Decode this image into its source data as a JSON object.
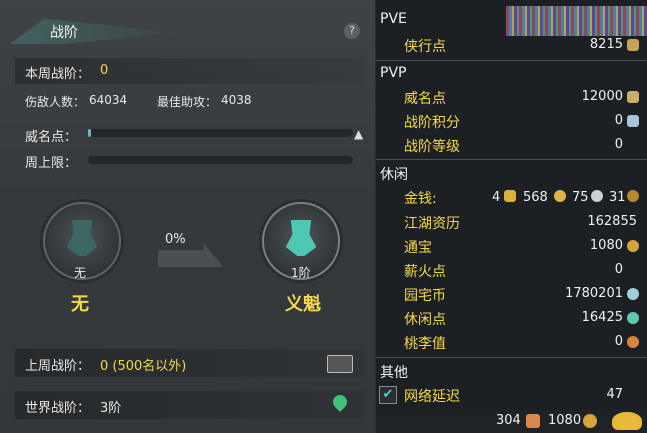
{
  "left": {
    "header_title": "战阶",
    "help": "?",
    "week_rank_label": "本周战阶：",
    "week_rank_value": "0",
    "kills_label": "伤敌人数：",
    "kills_value": "64034",
    "assist_label": "最佳助攻：",
    "assist_value": "4038",
    "fame_label": "威名点：",
    "fame_progress": 0.0,
    "weekly_cap_label": "周上限：",
    "weekly_cap_progress": 0.0,
    "current_rank_caption": "无",
    "current_rank_name": "无",
    "progress_percent": "0%",
    "next_rank_caption": "1阶",
    "next_rank_name": "义魁",
    "last_week_label": "上周战阶：",
    "last_week_value": "0 (500名以外)",
    "world_rank_label": "世界战阶：",
    "world_rank_value": "3阶"
  },
  "right": {
    "pve": {
      "title": "PVE",
      "items": [
        {
          "label": "侠行点",
          "value": "8215"
        }
      ]
    },
    "pvp": {
      "title": "PVP",
      "items": [
        {
          "label": "威名点",
          "value": "12000"
        },
        {
          "label": "战阶积分",
          "value": "0"
        },
        {
          "label": "战阶等级",
          "value": "0"
        }
      ]
    },
    "leisure": {
      "title": "休闲",
      "items": [
        {
          "label": "金钱:",
          "gold": "4",
          "silver": "568",
          "ingot": "75",
          "copper": "31"
        },
        {
          "label": "江湖资历",
          "value": "162855"
        },
        {
          "label": "通宝",
          "value": "1080"
        },
        {
          "label": "薪火点",
          "value": "0"
        },
        {
          "label": "园宅币",
          "value": "1780201"
        },
        {
          "label": "休闲点",
          "value": "16425"
        },
        {
          "label": "桃李值",
          "value": "0"
        }
      ]
    },
    "other": {
      "title": "其他",
      "items": [
        {
          "label": "网络延迟",
          "value": "47",
          "checked": true
        }
      ]
    },
    "bottom_bar": {
      "left_value": "304",
      "right_value": "1080"
    }
  },
  "colors": {
    "accent_yellow": "#f5d94a",
    "teal": "#4fc7b5",
    "panel_dark": "#1c2024"
  }
}
